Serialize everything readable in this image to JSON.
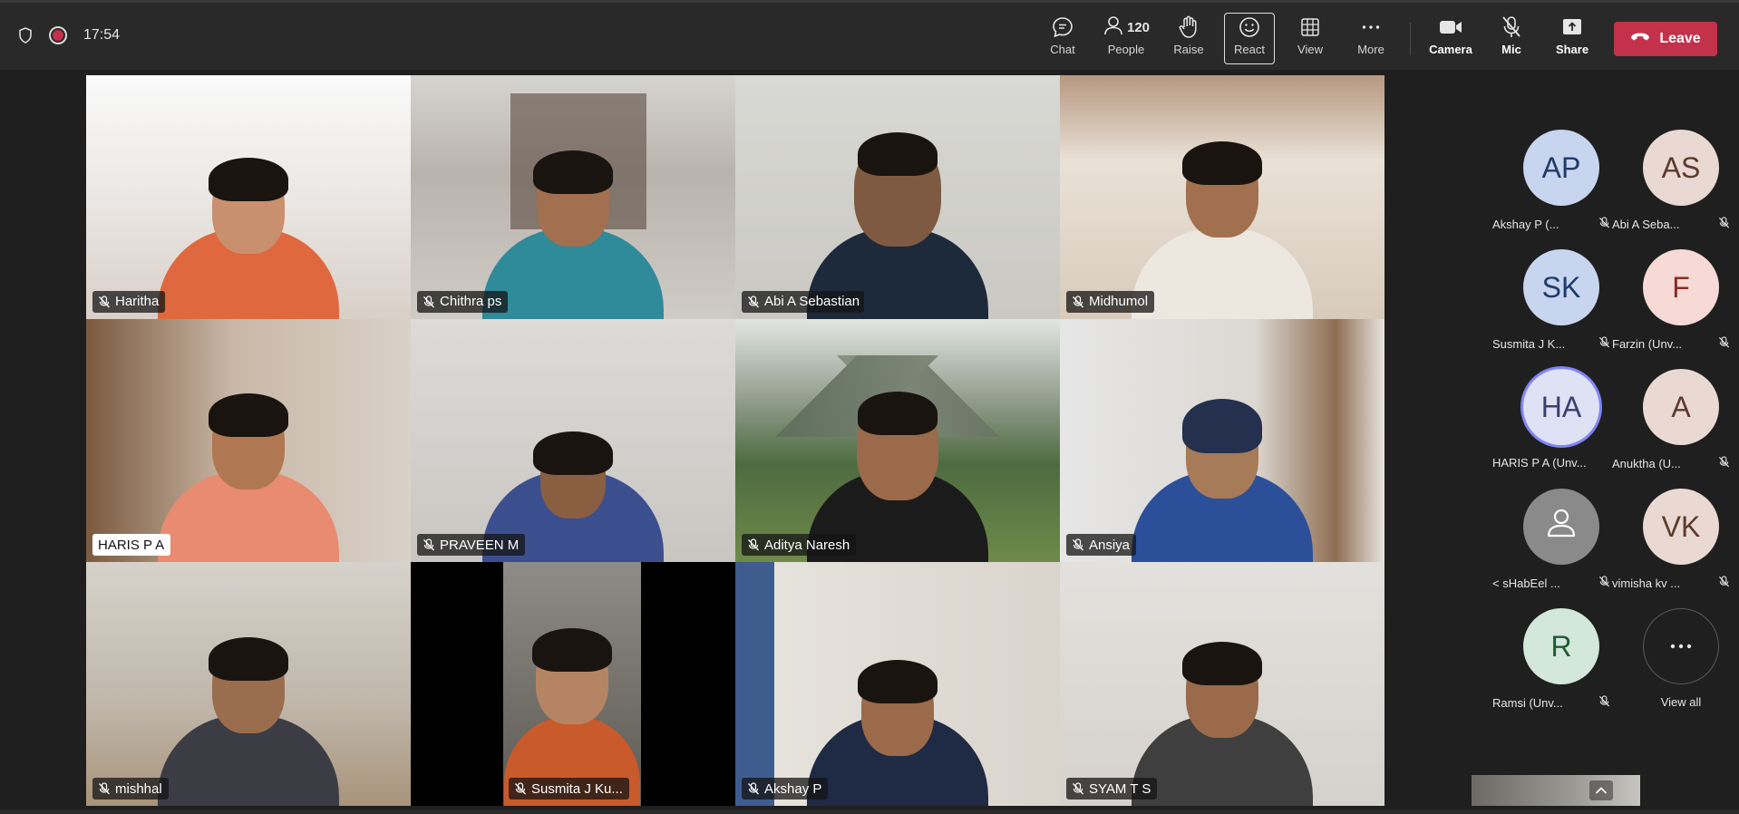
{
  "toolbar": {
    "timer": "17:54",
    "chat_label": "Chat",
    "people_label": "People",
    "people_count": "120",
    "raise_label": "Raise",
    "react_label": "React",
    "view_label": "View",
    "more_label": "More",
    "camera_label": "Camera",
    "mic_label": "Mic",
    "share_label": "Share",
    "leave_label": "Leave",
    "leave_color": "#c4314b"
  },
  "tiles": [
    {
      "name": "Haritha",
      "muted": true
    },
    {
      "name": "Chithra ps",
      "muted": true
    },
    {
      "name": "Abi A Sebastian",
      "muted": true
    },
    {
      "name": "Midhumol",
      "muted": true
    },
    {
      "name": "HARIS P A",
      "muted": false
    },
    {
      "name": "PRAVEEN M",
      "muted": true
    },
    {
      "name": "Aditya Naresh",
      "muted": true
    },
    {
      "name": "Ansiya",
      "muted": true
    },
    {
      "name": "mishhal",
      "muted": true
    },
    {
      "name": "Susmita J Ku...",
      "muted": true
    },
    {
      "name": "Akshay P",
      "muted": true
    },
    {
      "name": "SYAM T S",
      "muted": true
    }
  ],
  "participants": [
    {
      "initials": "AP",
      "name": "Akshay P (...",
      "bg": "#c7d5ee",
      "fg": "#1f3a6e"
    },
    {
      "initials": "AS",
      "name": "Abi A Seba...",
      "bg": "#ead9d3",
      "fg": "#5c3a2e"
    },
    {
      "initials": "SK",
      "name": "Susmita J K...",
      "bg": "#c7d5ee",
      "fg": "#1f3a6e"
    },
    {
      "initials": "F",
      "name": "Farzin (Unv...",
      "bg": "#f7d9d6",
      "fg": "#8a2c22"
    },
    {
      "initials": "HA",
      "name": "HARIS P A (Unv...",
      "bg": "#dfe1f5",
      "fg": "#39406e",
      "active": true
    },
    {
      "initials": "A",
      "name": "Anuktha (U...",
      "bg": "#ead9d3",
      "fg": "#5c3a2e"
    },
    {
      "initials": "",
      "name": "< sHabEel ...",
      "bg": "#8a8a8a",
      "fg": "#ffffff",
      "placeholder": true
    },
    {
      "initials": "VK",
      "name": "vimisha kv ...",
      "bg": "#ead9d3",
      "fg": "#5c3a2e"
    },
    {
      "initials": "R",
      "name": "Ramsi (Unv...",
      "bg": "#d3e7da",
      "fg": "#1f5a34"
    }
  ],
  "view_all_label": "View all"
}
